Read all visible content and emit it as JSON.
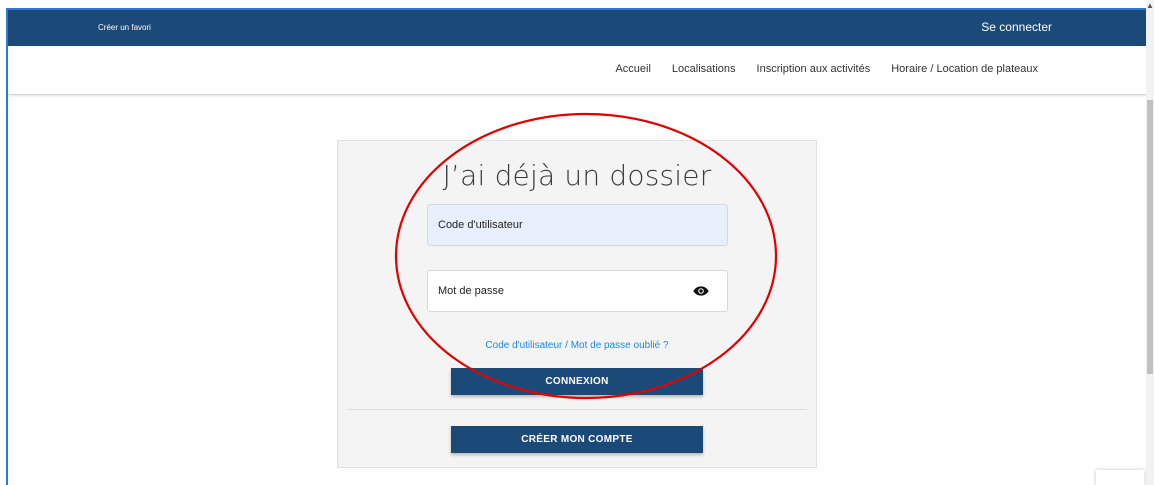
{
  "topbar": {
    "fav_link": "Créer un favori",
    "login_link": "Se connecter",
    "bg_color": "#1b4a78"
  },
  "nav": {
    "items": [
      {
        "label": "Accueil"
      },
      {
        "label": "Localisations"
      },
      {
        "label": "Inscription aux activités"
      },
      {
        "label": "Horaire / Location de plateaux"
      }
    ]
  },
  "login_card": {
    "title": "J’ai déjà un dossier",
    "username_placeholder": "Code d'utilisateur",
    "password_placeholder": "Mot de passe",
    "forgot_link": "Code d'utilisateur / Mot de passe oublié ?",
    "connexion_button": "CONNEXION",
    "create_button": "CRÉER MON COMPTE",
    "password_toggle_icon": "eye-icon"
  },
  "colors": {
    "brand": "#1b4a78",
    "link": "#1e88e5",
    "annotation": "#e00000",
    "autofill": "#e8f0fe"
  }
}
